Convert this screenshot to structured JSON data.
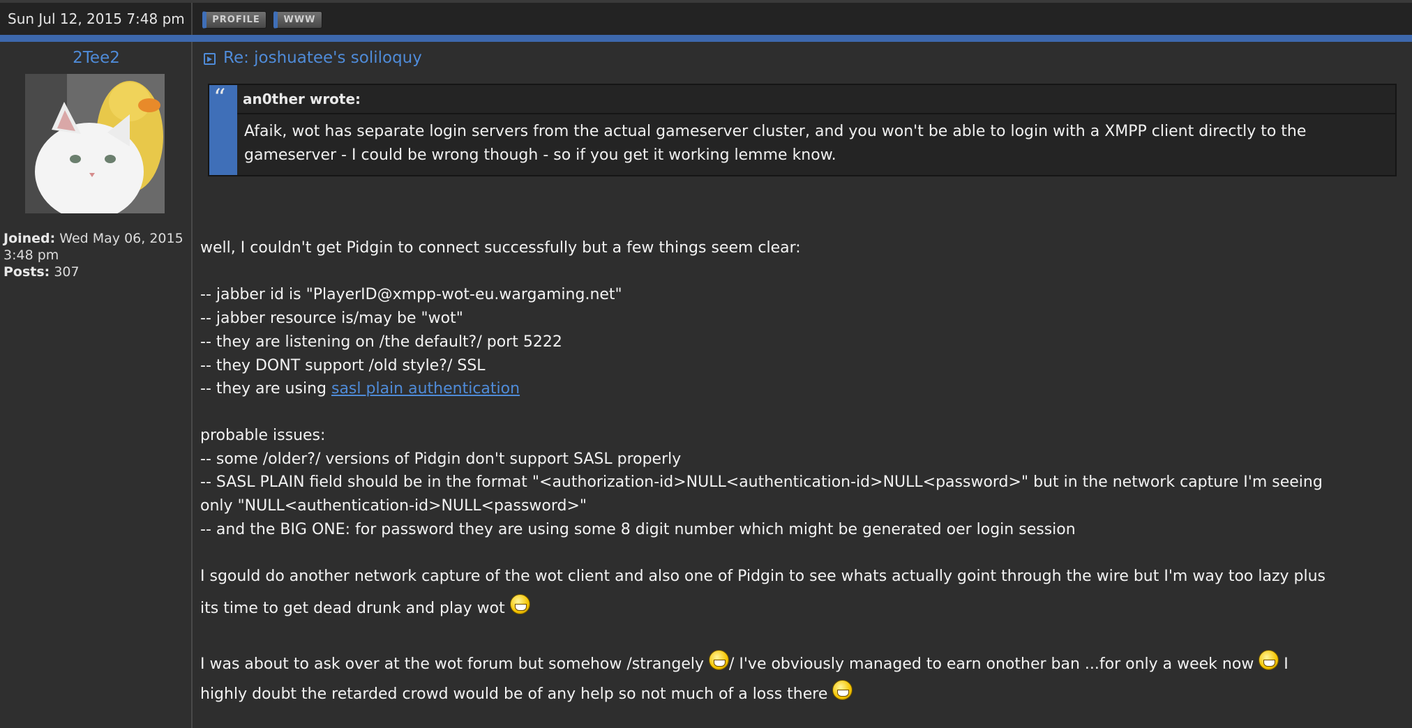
{
  "header": {
    "date": "Sun Jul 12, 2015 7:48 pm",
    "buttons": [
      "PROFILE",
      "WWW"
    ]
  },
  "author": {
    "username": "2Tee2",
    "joined_label": "Joined:",
    "joined_value": " Wed May 06, 2015",
    "joined_time": "3:48 pm",
    "posts_label": "Posts:",
    "posts_value": " 307"
  },
  "post": {
    "title": "Re: joshuatee's soliloquy",
    "quote": {
      "author": "an0ther wrote:",
      "line1": "Afaik, wot has separate login servers from the actual gameserver cluster, and you won't be able to login with a XMPP client directly to the",
      "line2": "gameserver - I could be wrong though - so if you get it working lemme know."
    },
    "lines": [
      "well, I couldn't get Pidgin to connect successfully but a few things seem clear:",
      "-- jabber id is \"PlayerID@xmpp-wot-eu.wargaming.net\"",
      "-- jabber resource is/may be \"wot\"",
      "-- they are listening on /the default?/ port 5222",
      "-- they DONT support /old style?/ SSL",
      "-- they are using ",
      "probable issues:",
      "-- some /older?/ versions of Pidgin don't support SASL properly",
      "-- SASL PLAIN field should be in the format \"<authorization-id>NULL<authentication-id>NULL<password>\" but in the network capture I'm seeing",
      "only \"NULL<authentication-id>NULL<password>\"",
      "-- and the BIG ONE: for password they are using some 8 digit number which might be generated oer login session",
      "I sgould do another network capture of the wot client and also one of Pidgin to see whats actually goint through the wire but I'm way too lazy plus",
      "its time to get dead drunk and play wot ",
      "I was about to ask over at the wot forum but somehow /strangely ",
      "/ I've obviously managed to earn onother ban ...for only a week now ",
      " I",
      "highly doubt the retarded crowd would be of any help so not much of a loss there "
    ],
    "link_text": "sasl plain authentication"
  }
}
